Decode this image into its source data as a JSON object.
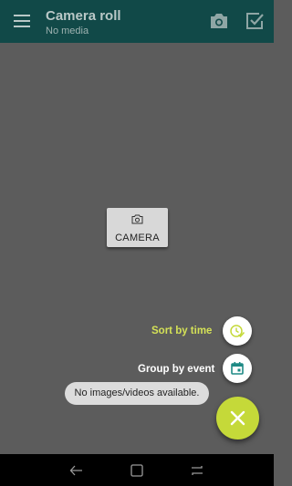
{
  "appbar": {
    "title": "Camera roll",
    "subtitle": "No media",
    "background_color": "#114948",
    "icons": [
      "menu-icon",
      "camera-icon",
      "select-checkbox-icon"
    ]
  },
  "empty_state": {
    "camera_button_label": "CAMERA",
    "camera_button_icon": "camera-icon"
  },
  "fab_menu": {
    "sort_by_time": {
      "label": "Sort by time",
      "label_color": "#d4e157",
      "icon": "clock-check-icon",
      "icon_color": "#c5d939"
    },
    "group_by_event": {
      "label": "Group by event",
      "label_color": "#ffffff",
      "icon": "calendar-icon",
      "icon_color": "#1f8a85"
    },
    "main_fab": {
      "icon": "close-icon",
      "color": "#c5d939"
    }
  },
  "toast": {
    "message": "No images/videos available."
  },
  "navbar": {
    "icons": [
      "back-icon",
      "overview-icon",
      "recents-icon"
    ]
  }
}
